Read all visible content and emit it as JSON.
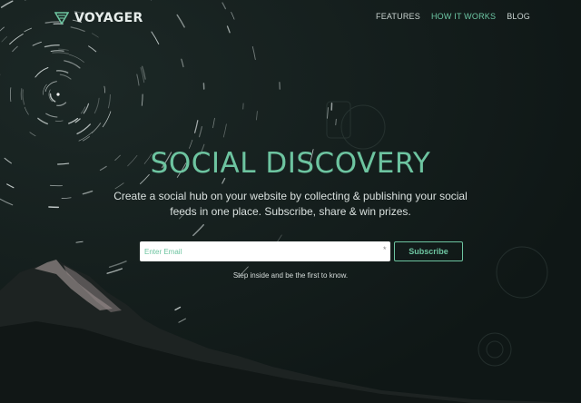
{
  "brand": {
    "name": "VOYAGER",
    "icon": "voyager-logo-icon",
    "accent": "#6dc4a0"
  },
  "nav": {
    "items": [
      {
        "label": "FEATURES",
        "active": false
      },
      {
        "label": "HOW IT WORKS",
        "active": true
      },
      {
        "label": "BLOG",
        "active": false
      }
    ]
  },
  "hero": {
    "title": "SOCIAL DISCOVERY",
    "subtitle": "Create a social hub on your website by collecting & publishing your social feeds in one place. Subscribe, share & win prizes."
  },
  "signup": {
    "email_placeholder": "Enter Email",
    "email_value": "",
    "required_marker": "*",
    "button_label": "Subscribe",
    "note": "Step inside and be the first to know."
  },
  "colors": {
    "background": "#121b1a",
    "accent": "#6dc4a0",
    "text": "#d9e0de"
  }
}
